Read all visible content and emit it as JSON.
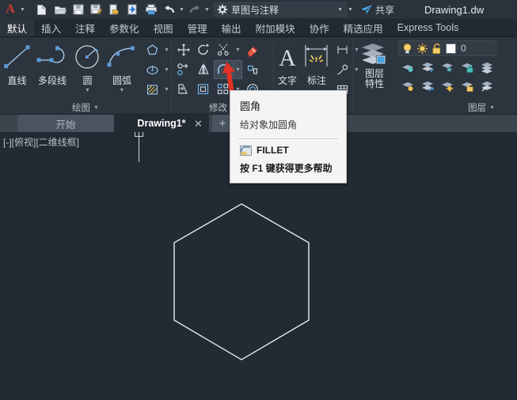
{
  "titlebar": {
    "app_logo": "autocad-A-logo",
    "quick_access": [
      {
        "name": "new-file-icon",
        "tip": "新建"
      },
      {
        "name": "open-folder-icon",
        "tip": "打开"
      },
      {
        "name": "save-icon",
        "tip": "保存"
      },
      {
        "name": "save-as-icon",
        "tip": "另存为"
      },
      {
        "name": "export-icon",
        "tip": "输出"
      },
      {
        "name": "publish-icon",
        "tip": "发布"
      },
      {
        "name": "print-icon",
        "tip": "打印"
      },
      {
        "name": "undo-icon",
        "tip": "放弃"
      },
      {
        "name": "redo-icon",
        "tip": "重做"
      }
    ],
    "workspace": "草图与注释",
    "share_label": "共享",
    "document_title": "Drawing1.dw"
  },
  "ribbon_tabs": [
    {
      "label": "默认",
      "active": true
    },
    {
      "label": "插入",
      "active": false
    },
    {
      "label": "注释",
      "active": false
    },
    {
      "label": "参数化",
      "active": false
    },
    {
      "label": "视图",
      "active": false
    },
    {
      "label": "管理",
      "active": false
    },
    {
      "label": "输出",
      "active": false
    },
    {
      "label": "附加模块",
      "active": false
    },
    {
      "label": "协作",
      "active": false
    },
    {
      "label": "精选应用",
      "active": false
    },
    {
      "label": "Express Tools",
      "active": false
    }
  ],
  "panels": {
    "draw": {
      "title": "绘图",
      "buttons": [
        {
          "label": "直线",
          "icon": "line-icon",
          "dropdown": false
        },
        {
          "label": "多段线",
          "icon": "polyline-icon",
          "dropdown": false
        },
        {
          "label": "圆",
          "icon": "circle-icon",
          "dropdown": true
        },
        {
          "label": "圆弧",
          "icon": "arc-icon",
          "dropdown": true
        }
      ],
      "small_buttons": [
        {
          "icon": "polygon-icon",
          "dropdown": true
        },
        {
          "icon": "ellipse-icon",
          "dropdown": true
        },
        {
          "icon": "hatch-icon",
          "dropdown": true
        }
      ]
    },
    "modify": {
      "title": "修改",
      "row1": [
        {
          "icon": "move-icon",
          "dropdown": false
        },
        {
          "icon": "rotate-icon",
          "dropdown": false
        },
        {
          "icon": "trim-icon",
          "dropdown": true
        },
        {
          "icon": "erase-icon",
          "dropdown": false
        }
      ],
      "row2": [
        {
          "icon": "copy-icon",
          "dropdown": false
        },
        {
          "icon": "mirror-icon",
          "dropdown": false
        },
        {
          "icon": "fillet-icon",
          "dropdown": true,
          "highlighted": true
        },
        {
          "icon": "explode-icon",
          "dropdown": false
        }
      ],
      "row3": [
        {
          "icon": "stretch-icon",
          "dropdown": false
        },
        {
          "icon": "scale-icon",
          "dropdown": false
        },
        {
          "icon": "array-icon",
          "dropdown": true
        },
        {
          "icon": "offset-icon",
          "dropdown": false
        }
      ]
    },
    "annotation": {
      "text_label": "文字",
      "text_icon": "text-A-icon",
      "dim_label": "标注",
      "dim_icon": "dimension-icon",
      "small_buttons": [
        {
          "icon": "linear-dimension-icon",
          "dropdown": true
        },
        {
          "icon": "leader-icon",
          "dropdown": true
        },
        {
          "icon": "table-icon",
          "dropdown": false
        }
      ]
    },
    "layers": {
      "title": "图层",
      "props_label_line1": "图层",
      "props_label_line2": "特性",
      "props_icon": "layer-properties-icon",
      "current_layer": "0",
      "layer_state_icons": [
        "lightbulb-icon",
        "sun-freeze-icon",
        "unlock-padlock-icon"
      ],
      "color_swatch": "#ffffff",
      "grid_icons": [
        "layer-isolate-icon",
        "layer-off-icon",
        "layer-freeze-icon",
        "layer-lock-icon",
        "layer-merge-icon",
        "layer-unisolate-icon",
        "layer-on-icon",
        "layer-thaw-icon",
        "layer-unlock-icon",
        "layer-delete-icon"
      ]
    }
  },
  "file_tabs": {
    "start_tab": "开始",
    "drawing_tab": "Drawing1*",
    "close_icon": "close-icon",
    "new_tab_icon": "plus-icon"
  },
  "canvas": {
    "viewport_label": "[-][俯视][二维线框]",
    "background_color": "#222b33",
    "shape": "hexagon",
    "shape_color": "#e8eaed",
    "crosshair": "crosshair-cursor"
  },
  "tooltip": {
    "title": "圆角",
    "description": "给对象加圆角",
    "command_icon": "fillet-command-icon",
    "command": "FILLET",
    "help_text": "按 F1 键获得更多帮助"
  },
  "annotation_arrow": {
    "name": "red-pointer-arrow",
    "color": "#e03127",
    "points_to": "fillet-button"
  }
}
